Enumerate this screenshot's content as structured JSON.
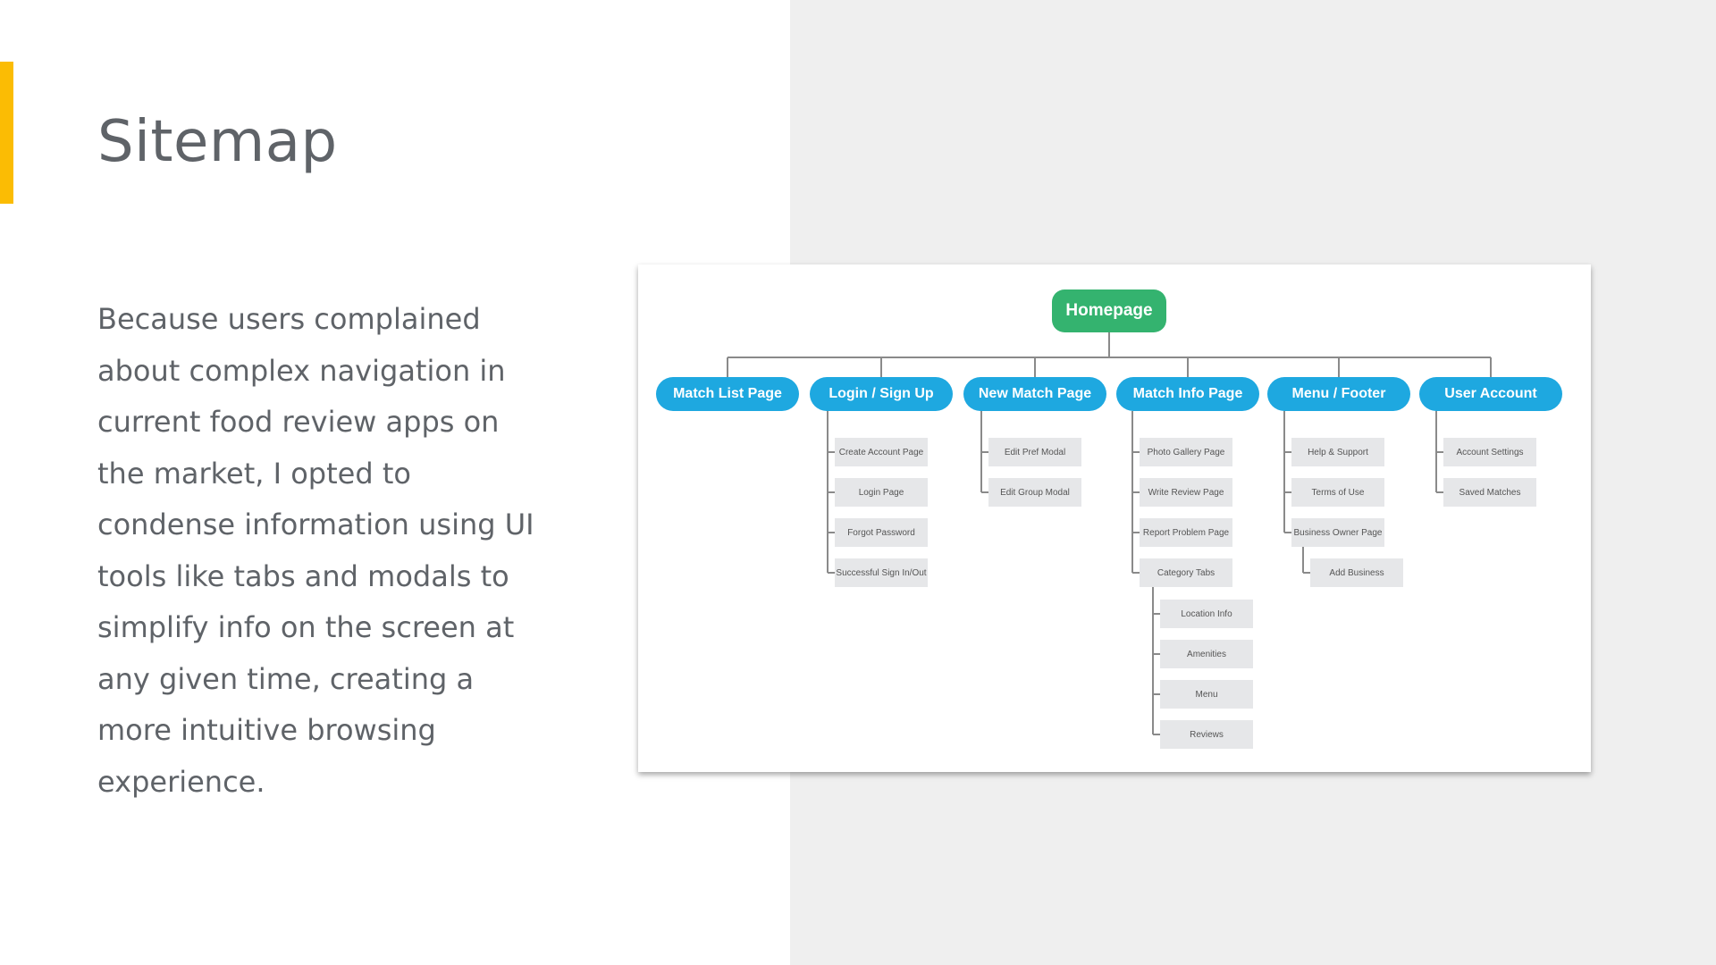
{
  "slide": {
    "title": "Sitemap",
    "description": "Because users complained about complex navigation in current food review apps on the market, I opted to condense information using UI tools like tabs and modals to simplify info on the screen at any given time, creating a more intuitive browsing experience."
  },
  "colors": {
    "accent": "#fbbc04",
    "root_node": "#34b36f",
    "section_node": "#1ea8e0",
    "page_node": "#e6e7e9",
    "panel_bg": "#efefef",
    "text": "#5f6368"
  },
  "sitemap": {
    "root": "Homepage",
    "sections": [
      {
        "label": "Match List Page",
        "pages": []
      },
      {
        "label": "Login / Sign Up",
        "pages": [
          "Create Account Page",
          "Login Page",
          "Forgot Password",
          "Successful Sign In/Out"
        ]
      },
      {
        "label": "New Match Page",
        "pages": [
          "Edit Pref Modal",
          "Edit Group Modal"
        ]
      },
      {
        "label": "Match Info Page",
        "pages": [
          "Photo Gallery Page",
          "Write Review Page",
          "Report Problem Page",
          "Category Tabs"
        ],
        "subpages": [
          "Location Info",
          "Amenities",
          "Menu",
          "Reviews"
        ]
      },
      {
        "label": "Menu / Footer",
        "pages": [
          "Help & Support",
          "Terms of Use",
          "Business Owner Page"
        ],
        "subpages": [
          "Add Business"
        ]
      },
      {
        "label": "User Account",
        "pages": [
          "Account Settings",
          "Saved Matches"
        ]
      }
    ]
  }
}
